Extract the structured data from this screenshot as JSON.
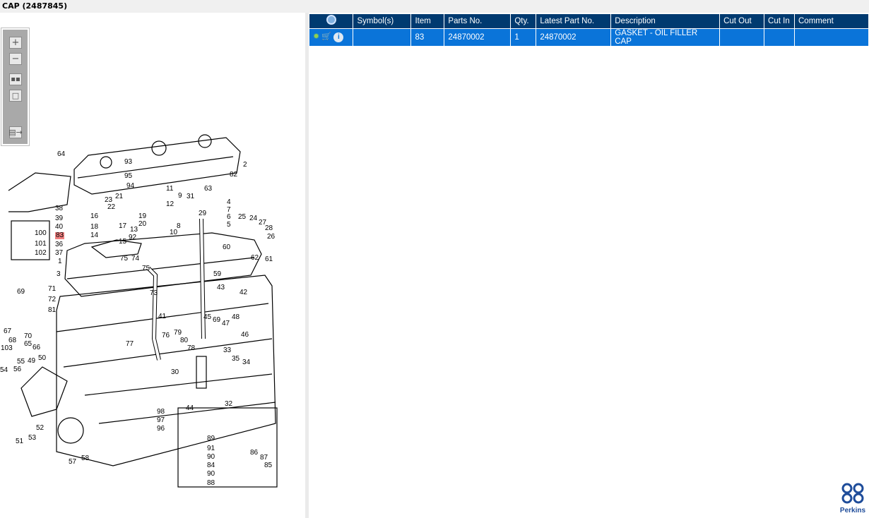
{
  "window": {
    "title": "CAP (2487845)"
  },
  "toolbar": {
    "zoom_in": "zoom-in",
    "zoom_out": "zoom-out",
    "fit": "fit",
    "actual": "actual",
    "export": "export"
  },
  "diagram": {
    "callouts": [
      "64",
      "2",
      "93",
      "95",
      "82",
      "94",
      "11",
      "63",
      "9",
      "31",
      "4",
      "21",
      "23",
      "12",
      "7",
      "38",
      "22",
      "19",
      "29",
      "25",
      "24",
      "6",
      "16",
      "39",
      "20",
      "8",
      "5",
      "27",
      "28",
      "40",
      "18",
      "17",
      "13",
      "10",
      "26",
      "100",
      "83",
      "14",
      "92",
      "36",
      "15",
      "101",
      "60",
      "37",
      "102",
      "1",
      "75",
      "74",
      "62",
      "61",
      "75",
      "3",
      "59",
      "43",
      "42",
      "69",
      "71",
      "72",
      "73",
      "81",
      "41",
      "45",
      "69",
      "48",
      "47",
      "67",
      "70",
      "46",
      "68",
      "79",
      "76",
      "80",
      "65",
      "66",
      "77",
      "103",
      "33",
      "78",
      "55",
      "49",
      "50",
      "35",
      "34",
      "54",
      "56",
      "30",
      "32",
      "44",
      "98",
      "97",
      "96",
      "52",
      "89",
      "53",
      "51",
      "91",
      "86",
      "90",
      "87",
      "57",
      "58",
      "85",
      "84",
      "90",
      "88"
    ],
    "highlighted": "83"
  },
  "table": {
    "headers": [
      "",
      "Symbol(s)",
      "Item",
      "Parts No.",
      "Qty.",
      "Latest Part No.",
      "Description",
      "Cut Out",
      "Cut In",
      "Comment"
    ],
    "rows": [
      {
        "symbols": "",
        "item": "83",
        "part_no": "24870002",
        "qty": "1",
        "latest_part_no": "24870002",
        "description": "GASKET - OIL FILLER CAP",
        "cut_out": "",
        "cut_in": "",
        "comment": ""
      }
    ]
  },
  "brand": {
    "name": "Perkins",
    "color": "#1e4c9a"
  },
  "colors": {
    "header": "#003a70",
    "selected_row": "#0a74d9",
    "highlight": "#f08080"
  }
}
